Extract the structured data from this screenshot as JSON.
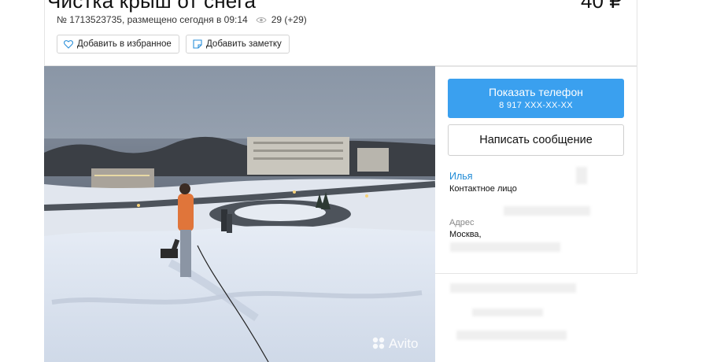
{
  "listing": {
    "title": "Чистка крыш от снега",
    "price": "40 ₽",
    "meta_id": "№ 1713523735, размещено сегодня в 09:14",
    "views": "29 (+29)"
  },
  "actions": {
    "favorite_label": "Добавить в избранное",
    "note_label": "Добавить заметку"
  },
  "contact": {
    "show_phone_label": "Показать телефон",
    "phone_masked": "8 917 XXX-XX-XX",
    "message_label": "Написать сообщение"
  },
  "seller": {
    "name": "Илья",
    "role": "Контактное лицо"
  },
  "address": {
    "label": "Адрес",
    "value": "Москва,"
  },
  "photo": {
    "watermark": "Avito"
  },
  "colors": {
    "accent": "#3aa0ef",
    "link": "#1f8bd6"
  }
}
